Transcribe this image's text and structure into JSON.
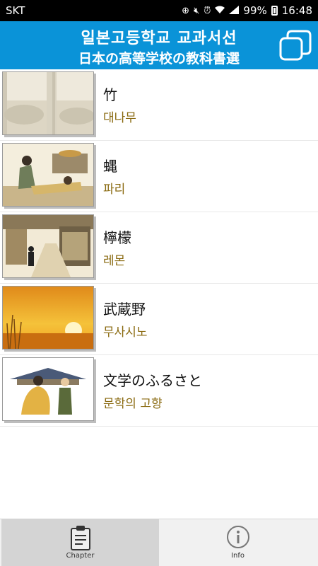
{
  "status_bar": {
    "carrier": "SKT",
    "battery": "99%",
    "time": "16:48"
  },
  "header": {
    "title_korean": "일본고등학교 교과서선",
    "title_japanese": "日本の高等学校の教科書選"
  },
  "chapters": [
    {
      "title": "竹",
      "subtitle": "대나무",
      "thumb_icon": "bamboo-illustration"
    },
    {
      "title": "蝿",
      "subtitle": "파리",
      "thumb_icon": "people-illustration"
    },
    {
      "title": "檸檬",
      "subtitle": "레몬",
      "thumb_icon": "street-illustration"
    },
    {
      "title": "武蔵野",
      "subtitle": "무사시노",
      "thumb_icon": "sunset-illustration"
    },
    {
      "title": "文学のふるさと",
      "subtitle": "문학의 고향",
      "thumb_icon": "samurai-illustration"
    }
  ],
  "bottom_nav": {
    "chapter_label": "Chapter",
    "info_label": "Info"
  },
  "colors": {
    "header": "#0a93d8",
    "subtitle": "#8a6a10",
    "active_tab": "#d4d4d4"
  }
}
